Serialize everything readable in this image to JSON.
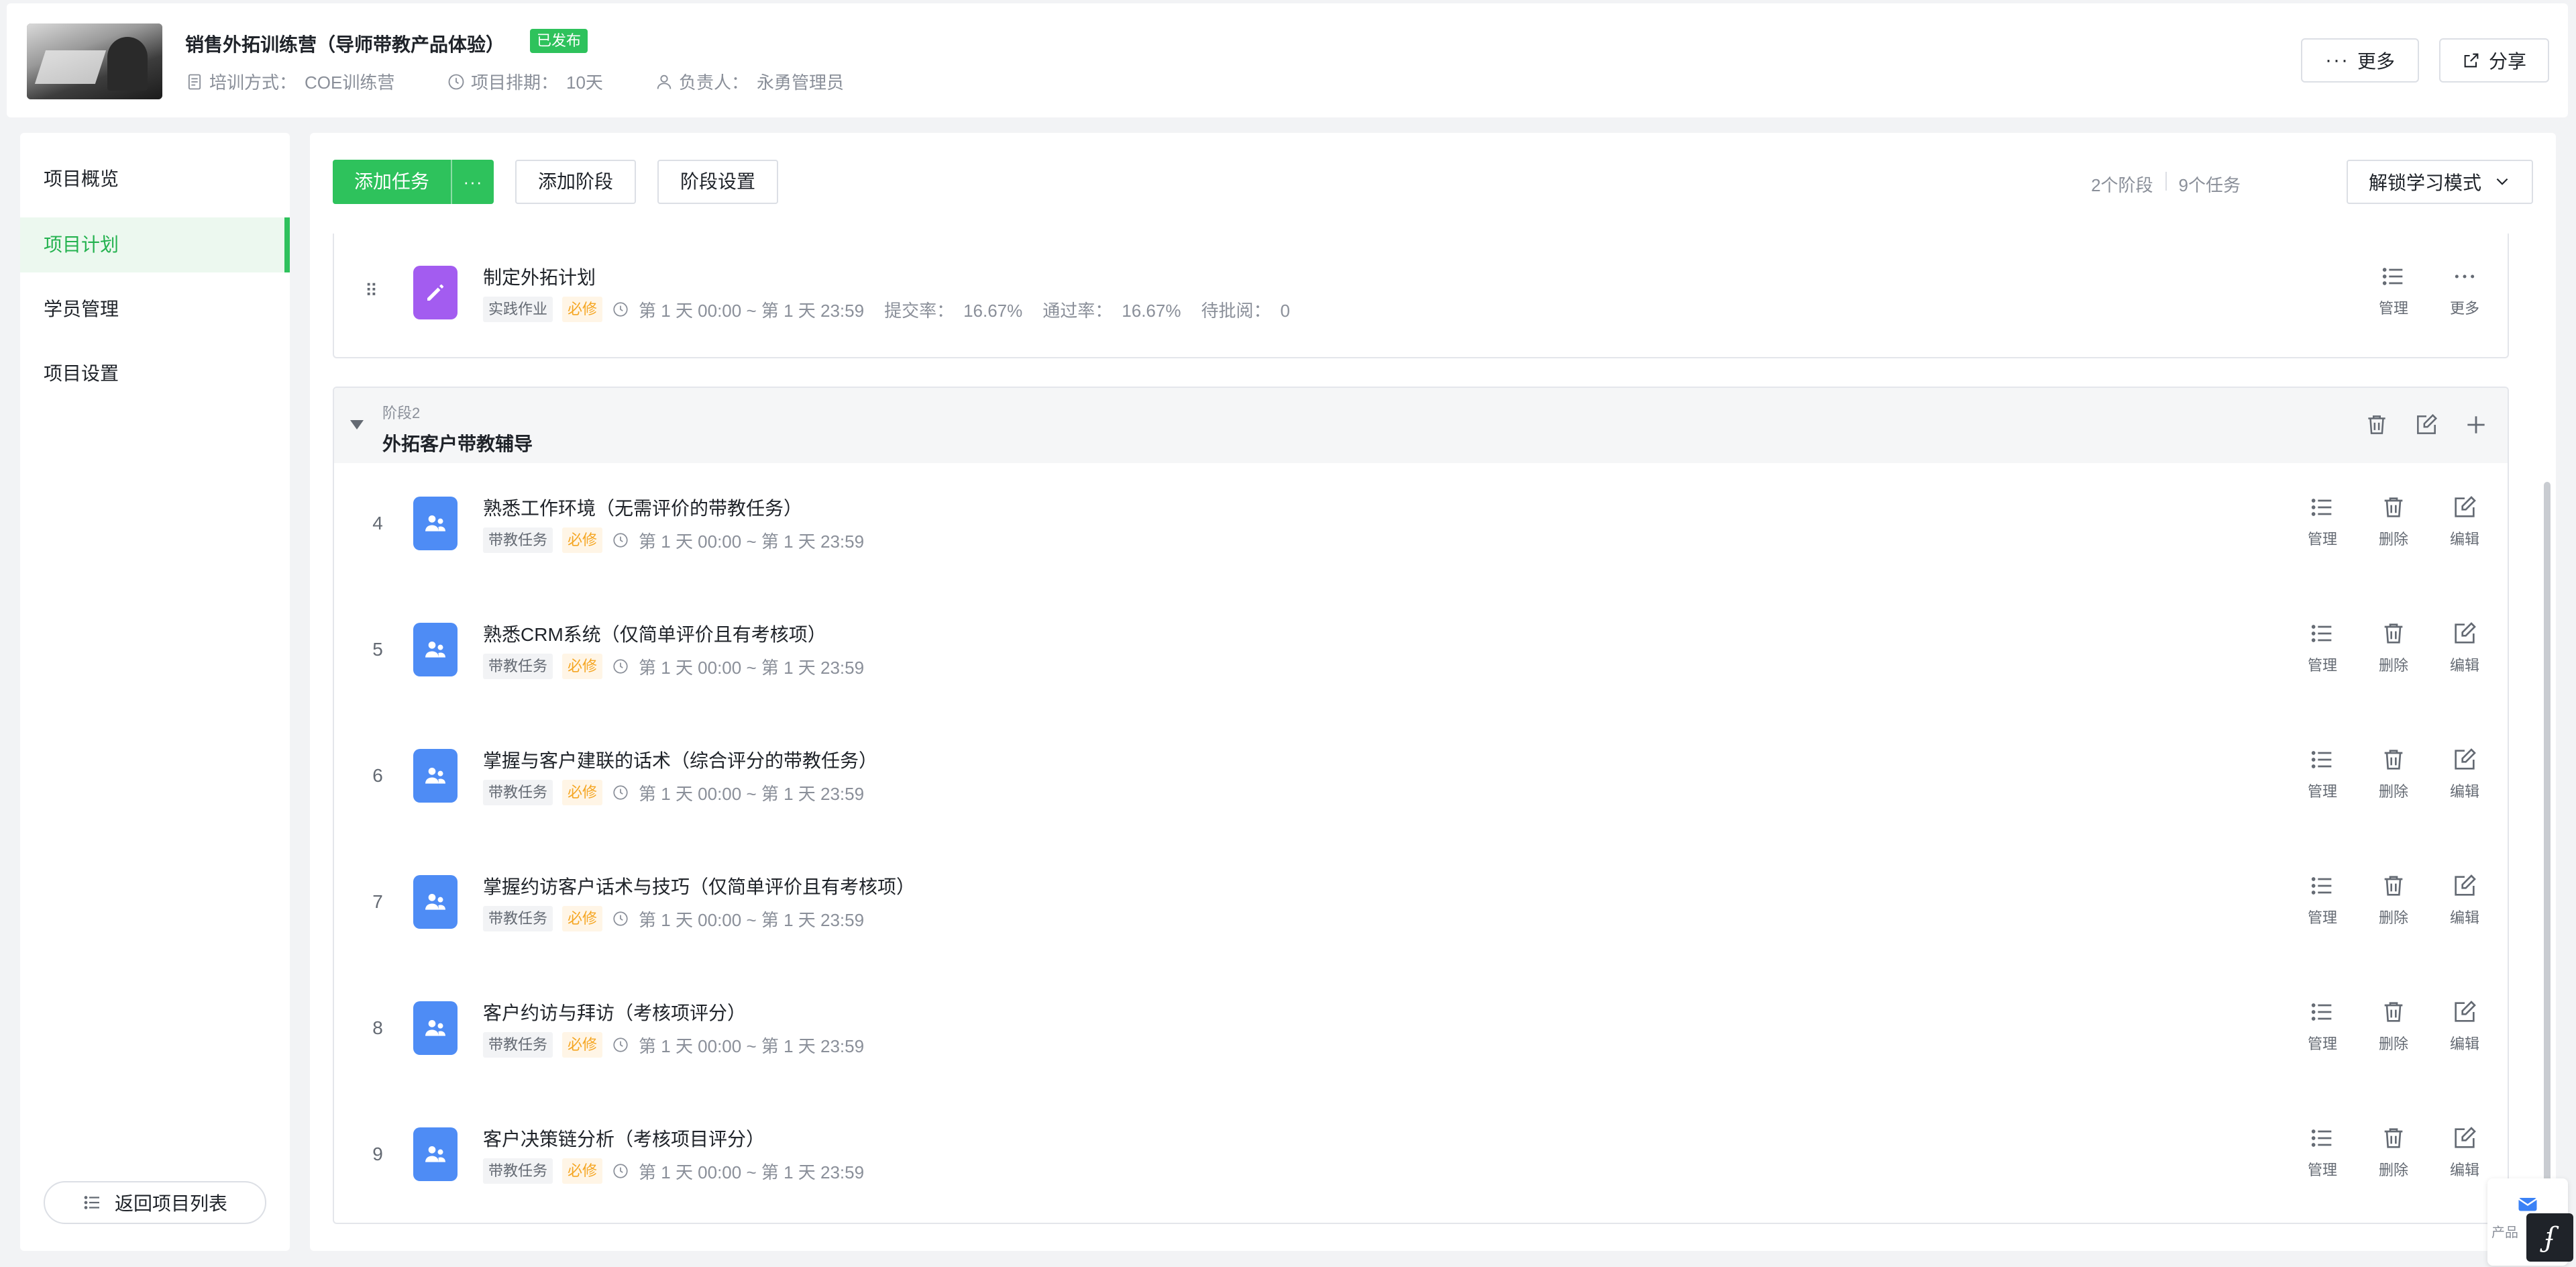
{
  "header": {
    "title": "销售外拓训练营（导师带教产品体验）",
    "status": "已发布",
    "meta": [
      {
        "label": "培训方式：",
        "value": "COE训练营",
        "icon": "document-icon"
      },
      {
        "label": "项目排期：",
        "value": "10天",
        "icon": "clock-icon"
      },
      {
        "label": "负责人：",
        "value": "永勇管理员",
        "icon": "person-icon"
      }
    ],
    "more_label": "更多",
    "share_label": "分享"
  },
  "sidebar": {
    "items": [
      {
        "label": "项目概览",
        "active": false
      },
      {
        "label": "项目计划",
        "active": true
      },
      {
        "label": "学员管理",
        "active": false
      },
      {
        "label": "项目设置",
        "active": false
      }
    ],
    "back_label": "返回项目列表"
  },
  "toolbar": {
    "add_task": "添加任务",
    "add_stage": "添加阶段",
    "stage_settings": "阶段设置",
    "stage_count": "2个阶段",
    "task_count": "9个任务",
    "mode": "解锁学习模式"
  },
  "colors": {
    "accent": "#2ec25c",
    "homework_icon": "#a35cf0",
    "mentor_icon": "#4e8cf5",
    "required": "#f5a623"
  },
  "first_task": {
    "name": "制定外拓计划",
    "tag": "实践作业",
    "required": "必修",
    "time": "第 1 天 00:00 ~ 第 1 天 23:59",
    "submit_label": "提交率：",
    "submit_value": "16.67%",
    "pass_label": "通过率：",
    "pass_value": "16.67%",
    "pending_label": "待批阅：",
    "pending_value": "0",
    "ops": [
      "管理",
      "更多"
    ]
  },
  "stage2": {
    "label": "阶段2",
    "name": "外拓客户带教辅导",
    "tasks": [
      {
        "num": "4",
        "name": "熟悉工作环境（无需评价的带教任务）",
        "tag": "带教任务",
        "required": "必修",
        "time": "第 1 天 00:00 ~ 第 1 天 23:59"
      },
      {
        "num": "5",
        "name": "熟悉CRM系统（仅简单评价且有考核项）",
        "tag": "带教任务",
        "required": "必修",
        "time": "第 1 天 00:00 ~ 第 1 天 23:59"
      },
      {
        "num": "6",
        "name": "掌握与客户建联的话术（综合评分的带教任务）",
        "tag": "带教任务",
        "required": "必修",
        "time": "第 1 天 00:00 ~ 第 1 天 23:59"
      },
      {
        "num": "7",
        "name": "掌握约访客户话术与技巧（仅简单评价且有考核项）",
        "tag": "带教任务",
        "required": "必修",
        "time": "第 1 天 00:00 ~ 第 1 天 23:59"
      },
      {
        "num": "8",
        "name": "客户约访与拜访（考核项评分）",
        "tag": "带教任务",
        "required": "必修",
        "time": "第 1 天 00:00 ~ 第 1 天 23:59"
      },
      {
        "num": "9",
        "name": "客户决策链分析（考核项目评分）",
        "tag": "带教任务",
        "required": "必修",
        "time": "第 1 天 00:00 ~ 第 1 天 23:59"
      }
    ],
    "ops": [
      "管理",
      "删除",
      "编辑"
    ]
  },
  "float_widget": {
    "label": "产品"
  }
}
